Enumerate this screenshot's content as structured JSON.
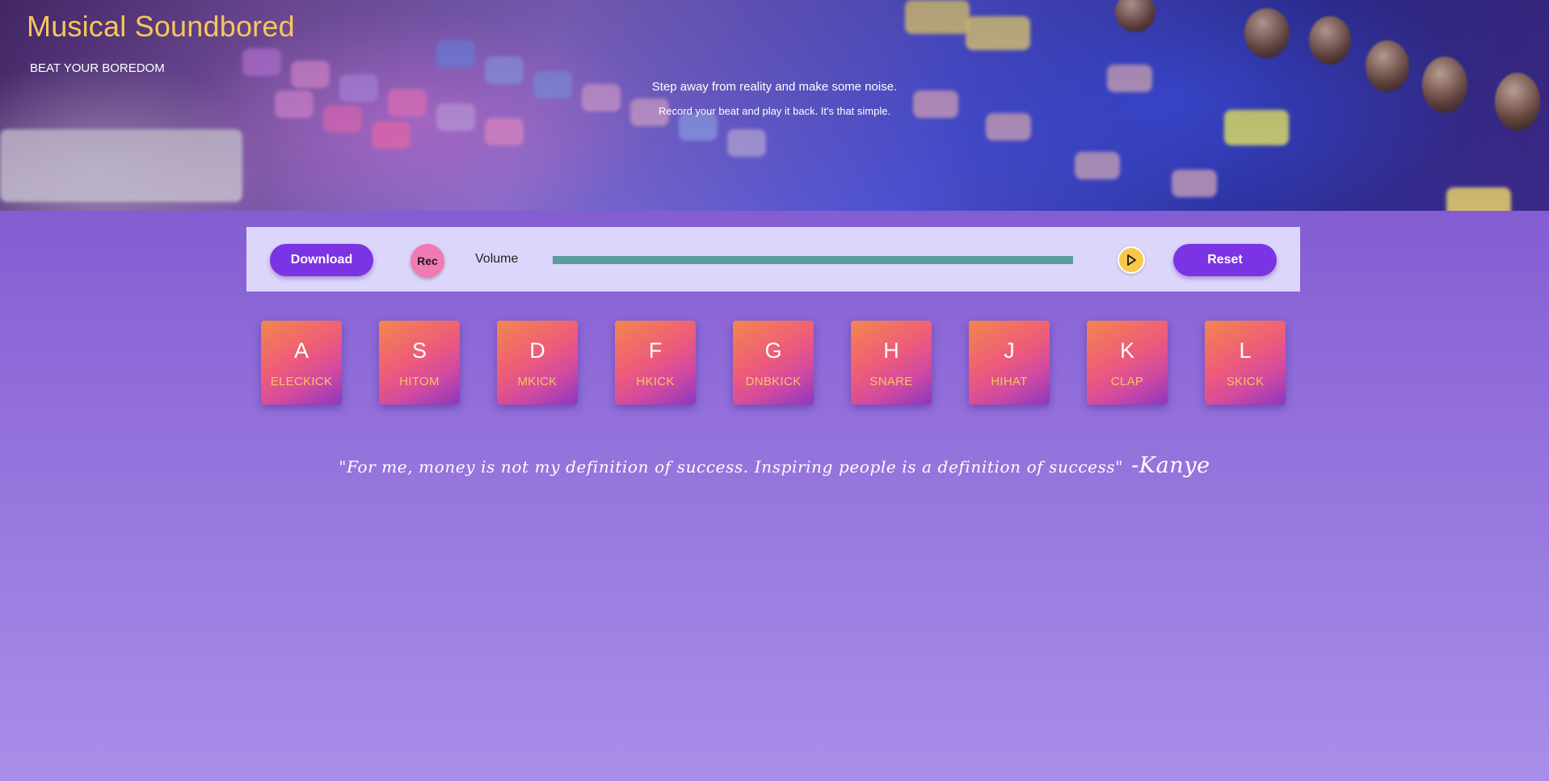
{
  "header": {
    "title": "Musical Soundbored",
    "tagline": "BEAT YOUR BOREDOM",
    "intro_line1": "Step away from reality and make some noise.",
    "intro_line2": "Record your beat and play it back. It's that simple."
  },
  "controls": {
    "download_label": "Download",
    "rec_label": "Rec",
    "volume_label": "Volume",
    "volume_level": 1.0,
    "play_icon": "play-icon",
    "reset_label": "Reset"
  },
  "pads": [
    {
      "key": "A",
      "sound": "ELECKICK"
    },
    {
      "key": "S",
      "sound": "HITOM"
    },
    {
      "key": "D",
      "sound": "MKICK"
    },
    {
      "key": "F",
      "sound": "HKICK"
    },
    {
      "key": "G",
      "sound": "DNBKICK"
    },
    {
      "key": "H",
      "sound": "SNARE"
    },
    {
      "key": "J",
      "sound": "HIHAT"
    },
    {
      "key": "K",
      "sound": "CLAP"
    },
    {
      "key": "L",
      "sound": "SKICK"
    }
  ],
  "quote": {
    "text": "\"For me, money is not my definition of success. Inspiring people is a definition of success\"",
    "author": "-Kanye"
  },
  "colors": {
    "accent": "#7b34e3",
    "title": "#f7c65c",
    "rec": "#f27ab3",
    "play": "#f7c84a",
    "volume_fill": "#5c9a9c",
    "control_bar": "#dcd6fb"
  }
}
